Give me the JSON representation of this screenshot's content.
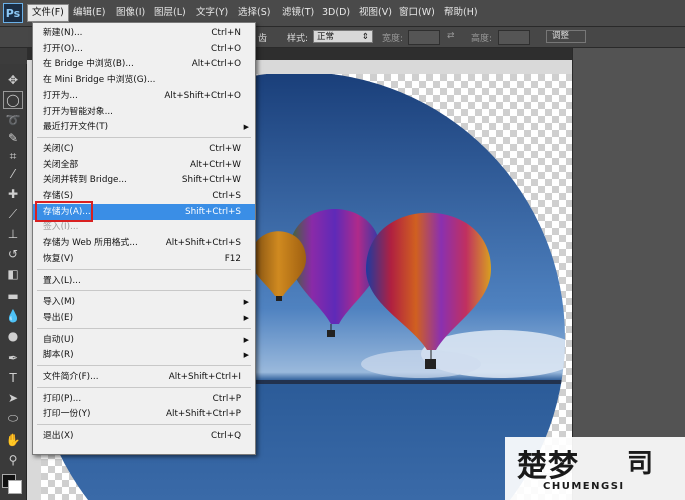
{
  "app": {
    "logo": "Ps"
  },
  "menubar": [
    {
      "label": "文件(F)",
      "active": true
    },
    {
      "label": "编辑(E)"
    },
    {
      "label": "图像(I)"
    },
    {
      "label": "图层(L)"
    },
    {
      "label": "文字(Y)"
    },
    {
      "label": "选择(S)"
    },
    {
      "label": "滤镜(T)"
    },
    {
      "label": "3D(D)"
    },
    {
      "label": "视图(V)"
    },
    {
      "label": "窗口(W)"
    },
    {
      "label": "帮助(H)"
    }
  ],
  "options_bar": {
    "partial_label": "齿",
    "style_label": "样式:",
    "style_value": "正常",
    "width_label": "宽度:",
    "height_label": "高度:",
    "adjust_label": "调整"
  },
  "file_menu": [
    {
      "label": "新建(N)...",
      "shortcut": "Ctrl+N"
    },
    {
      "label": "打开(O)...",
      "shortcut": "Ctrl+O"
    },
    {
      "label": "在 Bridge 中浏览(B)...",
      "shortcut": "Alt+Ctrl+O"
    },
    {
      "label": "在 Mini Bridge 中浏览(G)...",
      "shortcut": ""
    },
    {
      "label": "打开为...",
      "shortcut": "Alt+Shift+Ctrl+O"
    },
    {
      "label": "打开为智能对象...",
      "shortcut": ""
    },
    {
      "label": "最近打开文件(T)",
      "shortcut": "",
      "submenu": true
    },
    {
      "separator": true
    },
    {
      "label": "关闭(C)",
      "shortcut": "Ctrl+W"
    },
    {
      "label": "关闭全部",
      "shortcut": "Alt+Ctrl+W"
    },
    {
      "label": "关闭并转到 Bridge...",
      "shortcut": "Shift+Ctrl+W"
    },
    {
      "label": "存储(S)",
      "shortcut": "Ctrl+S"
    },
    {
      "label": "存储为(A)...",
      "shortcut": "Shift+Ctrl+S",
      "highlighted": true
    },
    {
      "label": "签入(I)...",
      "shortcut": "",
      "disabled": true
    },
    {
      "label": "存储为 Web 所用格式...",
      "shortcut": "Alt+Shift+Ctrl+S"
    },
    {
      "label": "恢复(V)",
      "shortcut": "F12"
    },
    {
      "separator": true
    },
    {
      "label": "置入(L)...",
      "shortcut": ""
    },
    {
      "separator": true
    },
    {
      "label": "导入(M)",
      "shortcut": "",
      "submenu": true
    },
    {
      "label": "导出(E)",
      "shortcut": "",
      "submenu": true
    },
    {
      "separator": true
    },
    {
      "label": "自动(U)",
      "shortcut": "",
      "submenu": true
    },
    {
      "label": "脚本(R)",
      "shortcut": "",
      "submenu": true
    },
    {
      "separator": true
    },
    {
      "label": "文件简介(F)...",
      "shortcut": "Alt+Shift+Ctrl+I"
    },
    {
      "separator": true
    },
    {
      "label": "打印(P)...",
      "shortcut": "Ctrl+P"
    },
    {
      "label": "打印一份(Y)",
      "shortcut": "Alt+Shift+Ctrl+P"
    },
    {
      "separator": true
    },
    {
      "label": "退出(X)",
      "shortcut": "Ctrl+Q"
    }
  ],
  "watermark": {
    "cn_left": "楚梦",
    "cn_right": "司",
    "en": "CHUMENGSI"
  },
  "colors": {
    "menu_highlight": "#3a8ee6",
    "callout_border": "#d92020",
    "sky_top": "#1a3f7a",
    "sea": "#3a6aa8"
  }
}
